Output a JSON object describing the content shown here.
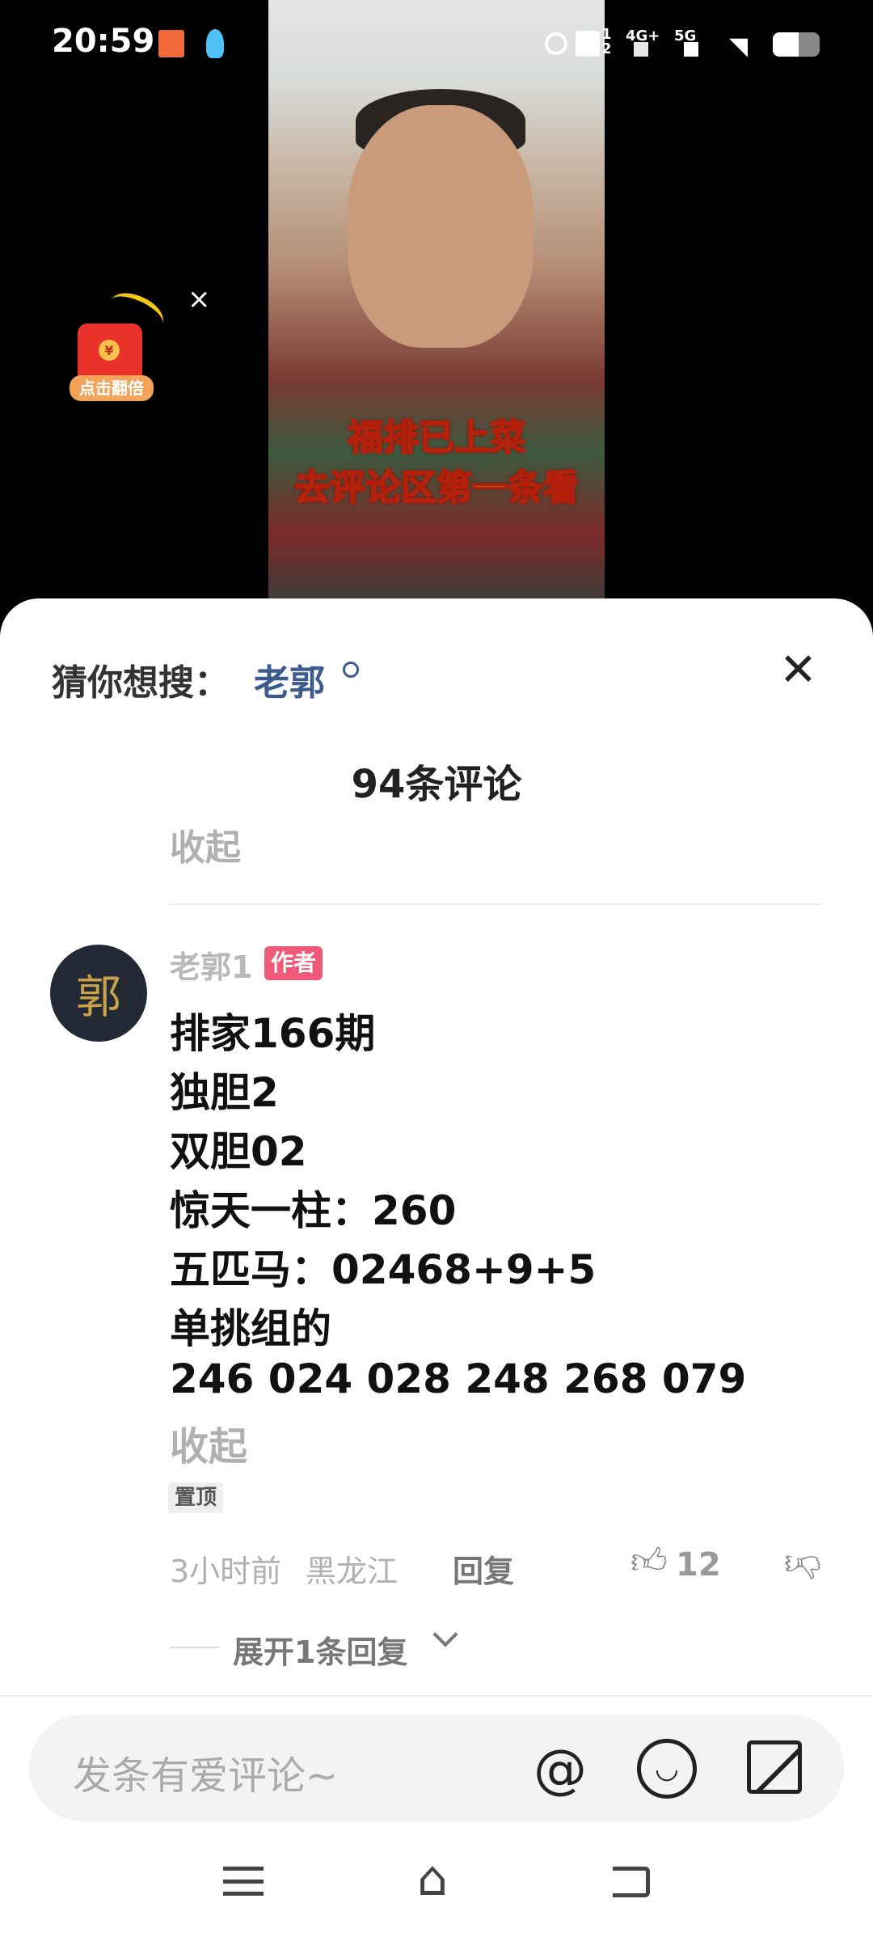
{
  "status_bar": {
    "time": "20:59",
    "sim1": "1",
    "sim2": "2",
    "net1": "4G+",
    "net2": "5G"
  },
  "video": {
    "caption_line1": "福排已上菜",
    "caption_line2": "去评论区第一条看"
  },
  "red_envelope": {
    "label": "点击翻倍",
    "symbol": "¥"
  },
  "search_suggest": {
    "label": "猜你想搜：",
    "keyword": "老郭"
  },
  "comments": {
    "title": "94条评论",
    "collapse_top": "收起"
  },
  "comment": {
    "author": "老郭1",
    "author_badge": "作者",
    "avatar_char": "郭",
    "lines": [
      "排家166期",
      "独胆2",
      "双胆02",
      "惊天一柱：260",
      "五匹马：02468+9+5",
      "单挑组的",
      "246 024 028 248 268 079"
    ],
    "collapse": "收起",
    "pinned": "置顶",
    "time": "3小时前",
    "location": "黑龙江",
    "reply": "回复",
    "likes": "12",
    "expand_replies": "展开1条回复"
  },
  "input": {
    "placeholder": "发条有爱评论~"
  },
  "colors": {
    "badge": "#ee5a78",
    "keyword": "#3d5a8c"
  }
}
